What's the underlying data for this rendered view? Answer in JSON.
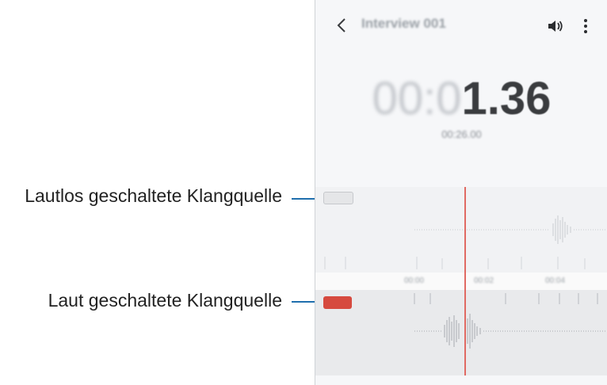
{
  "callouts": {
    "muted_label": "Lautlos geschaltete Klangquelle",
    "unmuted_label": "Laut geschaltete Klangquelle"
  },
  "header": {
    "title": "Interview 001",
    "back_icon": "chevron-left-icon",
    "speaker_icon": "speaker-icon",
    "more_icon": "more-vertical-icon"
  },
  "timer": {
    "dim_part": "00:0",
    "main_part": "1.36",
    "total": "00:26.00"
  },
  "timeline": {
    "ticks": [
      "00:00",
      "00:02",
      "00:04"
    ]
  },
  "colors": {
    "accent_line": "#1f6fae",
    "unmuted_chip": "#d64a3f",
    "playhead": "#e06a63"
  }
}
